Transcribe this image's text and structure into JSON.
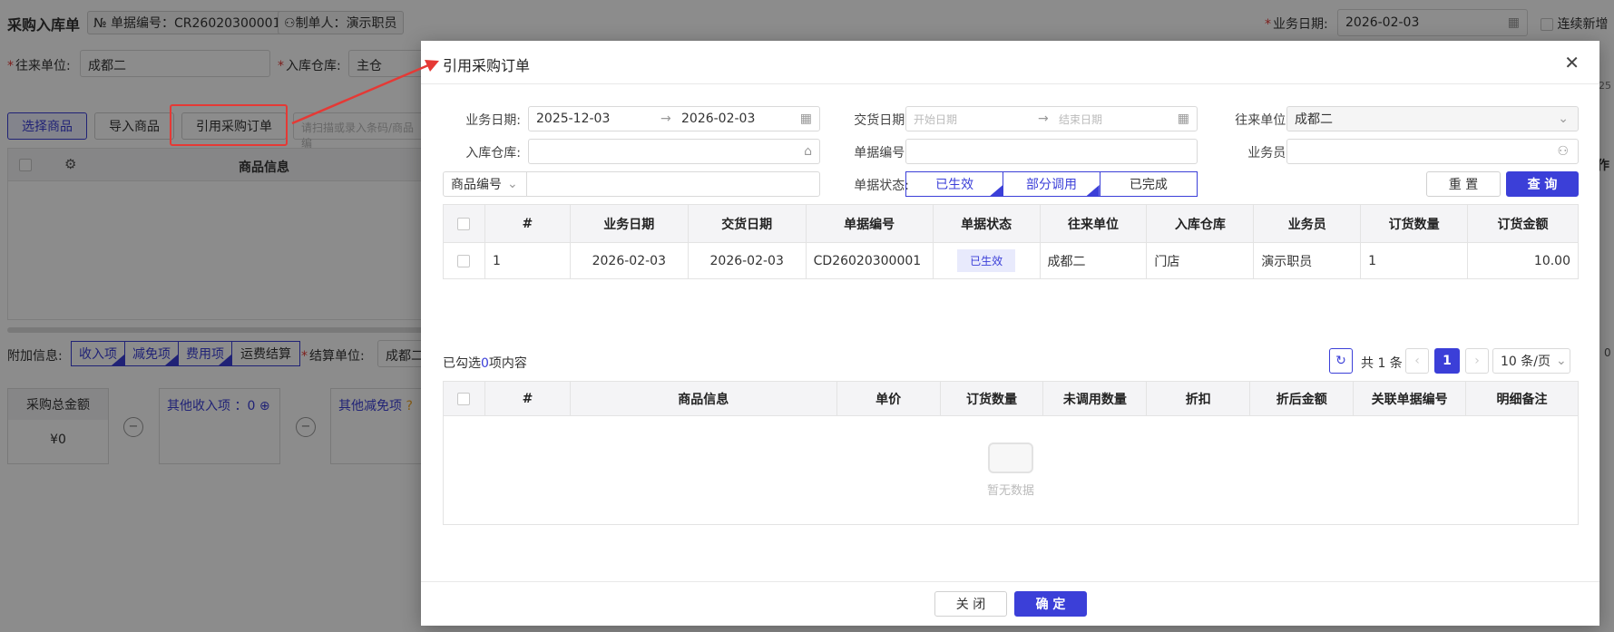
{
  "page": {
    "title": "采购入库单",
    "doc_no_label": "№ 单据编号：",
    "doc_no": "CR26020300001",
    "creator_label": "制单人：",
    "creator": "演示职员",
    "biz_date_label": "业务日期:",
    "biz_date": "2026-02-03",
    "continuous_add": "连续新增",
    "partner_label": "往来单位:",
    "partner": "成都二",
    "warehouse_label": "入库仓库:",
    "warehouse": "主仓",
    "btn_select_goods": "选择商品",
    "btn_import_goods": "导入商品",
    "btn_ref_po": "引用采购订单",
    "scan_placeholder": "请扫描或录入条码/商品编",
    "col_goods_info": "商品信息",
    "col_right": "作",
    "extra_info_label": "附加信息:",
    "extra_tabs": [
      "收入项",
      "减免项",
      "费用项",
      "运费结算"
    ],
    "settle_label": "结算单位:",
    "settle_value": "成都二",
    "total_label": "采购总金额",
    "total_value": "¥0",
    "other_income": "其他收入项 ：0",
    "other_reduce": "其他减免项",
    "right_edge_a": "25",
    "right_edge_b": "0"
  },
  "modal": {
    "title": "引用采购订单",
    "filters": {
      "biz_date_label": "业务日期:",
      "biz_date_start": "2025-12-03",
      "biz_date_end": "2026-02-03",
      "delivery_date_label": "交货日期:",
      "delivery_start_placeholder": "开始日期",
      "delivery_end_placeholder": "结束日期",
      "partner_label": "往来单位:",
      "partner": "成都二",
      "warehouse_label": "入库仓库:",
      "doc_no_label": "单据编号:",
      "salesman_label": "业务员:",
      "goods_code_select": "商品编号",
      "status_label": "单据状态:",
      "status_options": [
        "已生效",
        "部分调用",
        "已完成"
      ],
      "reset": "重 置",
      "query": "查 询"
    },
    "orders_table": {
      "headers": [
        "#",
        "业务日期",
        "交货日期",
        "单据编号",
        "单据状态",
        "往来单位",
        "入库仓库",
        "业务员",
        "订货数量",
        "订货金额"
      ],
      "rows": [
        [
          "1",
          "2026-02-03",
          "2026-02-03",
          "CD26020300001",
          "已生效",
          "成都二",
          "门店",
          "演示职员",
          "1",
          "10.00"
        ]
      ]
    },
    "selected_prefix": "已勾选",
    "selected_count": "0",
    "selected_suffix": "项内容",
    "pagination": {
      "total": "共 1 条",
      "current": "1",
      "page_size": "10 条/页"
    },
    "detail_table": {
      "headers": [
        "#",
        "商品信息",
        "单价",
        "订货数量",
        "未调用数量",
        "折扣",
        "折后金额",
        "关联单据编号",
        "明细备注"
      ],
      "empty_text": "暂无数据"
    },
    "btn_close": "关 闭",
    "btn_confirm": "确 定"
  },
  "colors": {
    "primary": "#3b3fd8",
    "annotation": "#e53935"
  }
}
